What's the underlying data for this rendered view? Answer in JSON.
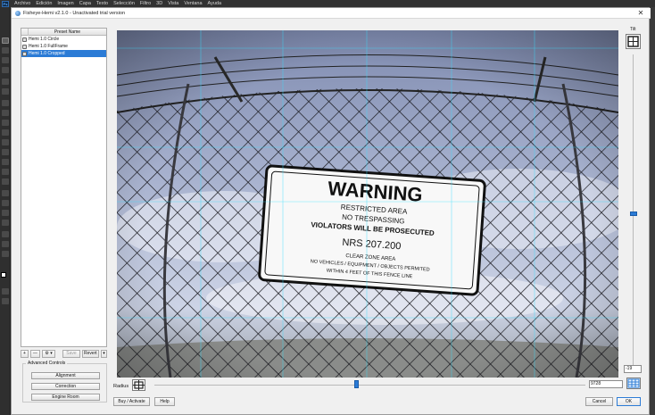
{
  "ps_menubar": {
    "logo": "Ps",
    "items": [
      "Archivo",
      "Edición",
      "Imagen",
      "Capa",
      "Texto",
      "Selección",
      "Filtro",
      "3D",
      "Vista",
      "Ventana",
      "Ayuda"
    ]
  },
  "dialog": {
    "title": "Fisheye-Hemi v2.1.0 - Unactivated trial version",
    "close": "✕"
  },
  "presets": {
    "header": "Preset Name",
    "items": [
      {
        "label": "Hemi 1.0 Circle",
        "selected": false
      },
      {
        "label": "Hemi 1.0 FullFrame",
        "selected": false
      },
      {
        "label": "Hemi 1.0 Cropped",
        "selected": true
      }
    ],
    "toolbar": {
      "add": "+",
      "remove": "—",
      "gear": "⚙ ▾",
      "save": "Save",
      "revert": "Revert",
      "revert_arrow": "▾"
    }
  },
  "advanced": {
    "title": "Advanced Controls",
    "buttons": [
      "Alignment",
      "Correction",
      "Engine Room"
    ]
  },
  "preview": {
    "sign": {
      "heading": "WARNING",
      "line1": "RESTRICTED AREA",
      "line2": "NO TRESPASSING",
      "line3": "VIOLATORS WILL BE PROSECUTED",
      "code": "NRS 207.200",
      "line4": "CLEAR ZONE AREA",
      "line5": "NO VEHICLES / EQUIPMENT / OBJECTS PERMITED",
      "line6": "WITHIN 4 FEET OF THIS FENCE LINE"
    }
  },
  "tilt": {
    "label": "Tilt",
    "value": "-19"
  },
  "radius": {
    "label": "Radius",
    "value": "9728"
  },
  "footer": {
    "buy": "Buy / Activate",
    "help": "Help",
    "cancel": "Cancel",
    "ok": "OK"
  },
  "colors": {
    "accent": "#2b7bd6",
    "guide": "#37e0ff"
  }
}
